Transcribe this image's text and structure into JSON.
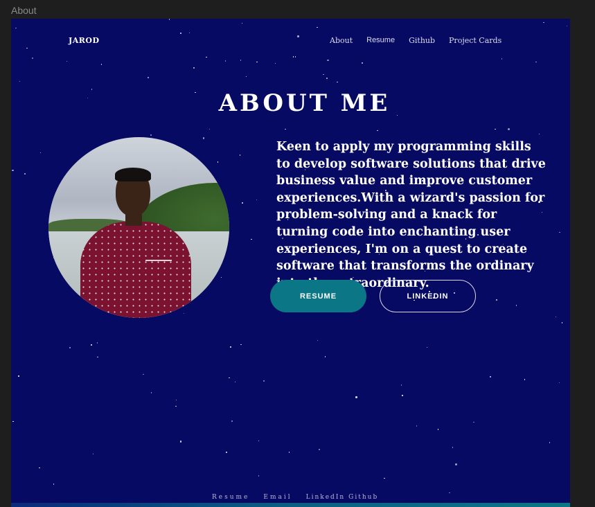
{
  "editor": {
    "label": "About"
  },
  "brand": {
    "name": "JAROD"
  },
  "nav": {
    "items": [
      {
        "label": "About"
      },
      {
        "label": "Resume"
      },
      {
        "label": "Github"
      },
      {
        "label": "Project Cards"
      }
    ]
  },
  "hero": {
    "title": "ABOUT ME",
    "bio": "Keen to apply my programming skills to develop software solutions that drive business value and improve customer experiences.With a wizard's passion for problem-solving and a knack for turning code into enchanting user experiences, I'm on a quest to create software that transforms the ordinary into the extraordinary."
  },
  "buttons": {
    "resume": "RESUME",
    "linkedin": "LINKEDIN"
  },
  "footer": {
    "links": [
      {
        "label": "Resume"
      },
      {
        "label": "Email"
      },
      {
        "label": "LinkedIn"
      },
      {
        "label": "Github"
      }
    ]
  },
  "colors": {
    "background": "#070a63",
    "accent": "#0b7686",
    "text": "#ffffff"
  }
}
